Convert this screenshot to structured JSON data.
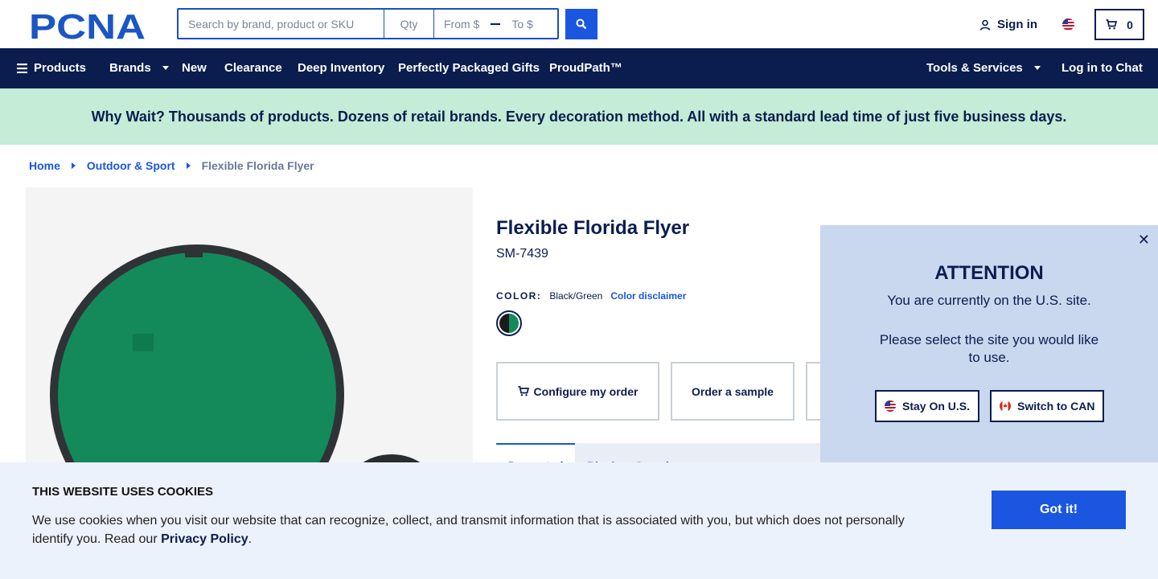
{
  "header": {
    "logo_text": "PCNA",
    "search_placeholder": "Search by brand, product or SKU",
    "qty_placeholder": "Qty",
    "from_placeholder": "From $",
    "to_placeholder": "To $",
    "signin_label": "Sign in",
    "cart_count": "0"
  },
  "nav": {
    "items": [
      "Products",
      "Brands",
      "New",
      "Clearance",
      "Deep Inventory",
      "Perfectly Packaged Gifts",
      "ProudPath™"
    ],
    "tools": "Tools & Services",
    "chat": "Log in to Chat"
  },
  "promo": "Why Wait? Thousands of products. Dozens of retail brands. Every decoration method. All with a standard lead time of just five business days.",
  "breadcrumb": [
    "Home",
    "Outdoor & Sport",
    "Flexible Florida Flyer"
  ],
  "product": {
    "title": "Flexible Florida Flyer",
    "sku": "SM-7439",
    "color_label": "COLOR:",
    "color_value": "Black/Green",
    "color_disclaimer": "Color disclaimer",
    "actions": [
      "Configure my order",
      "Order a sample"
    ],
    "tabs": [
      "Decorated",
      "Blank or Sample"
    ]
  },
  "popup": {
    "title": "ATTENTION",
    "line1": "You are currently on the U.S. site.",
    "line2": "Please select the site you would like to use.",
    "stay": "Stay On U.S.",
    "switch": "Switch to CAN"
  },
  "cookie": {
    "title": "THIS WEBSITE USES COOKIES",
    "text": "We use cookies when you visit our website that can recognize, collect, and transmit information that is associated with you, but which does not personally identify you. Read our ",
    "link": "Privacy Policy",
    "end": ".",
    "button": "Got it!"
  },
  "colors": {
    "navy": "#0b1d4f",
    "accent": "#1a56e0",
    "promo_bg": "#c4ecd6"
  }
}
